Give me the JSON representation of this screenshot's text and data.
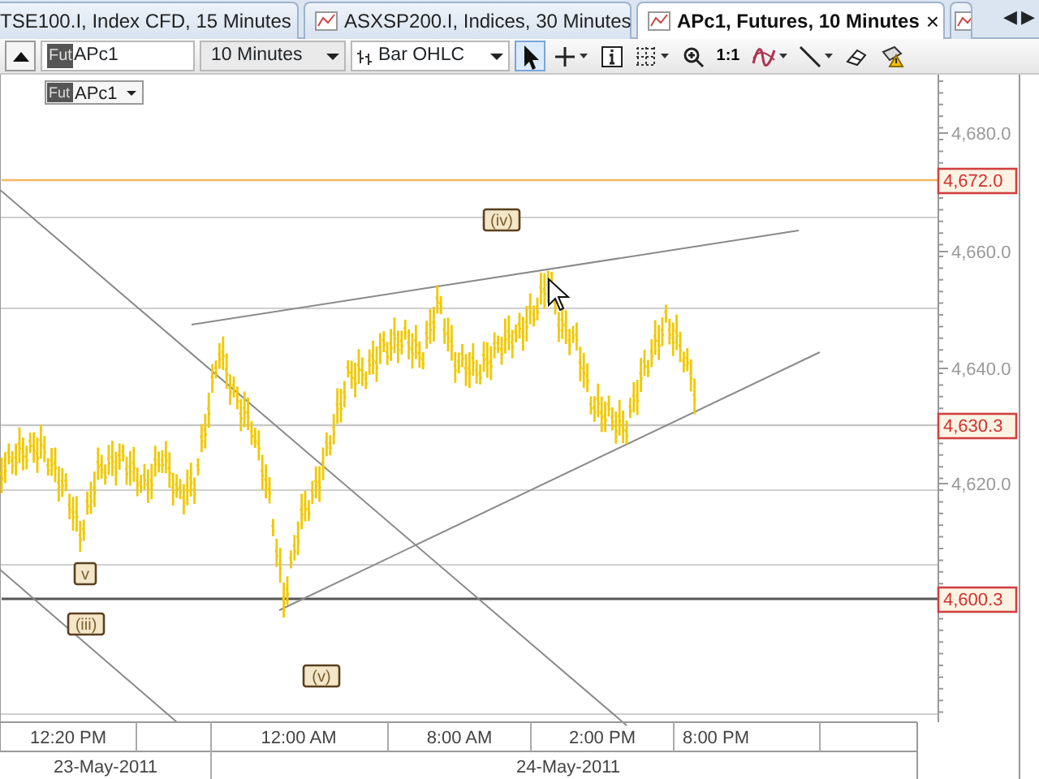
{
  "tabs": [
    {
      "label": "TSE100.I, Index CFD, 15 Minutes",
      "selected": false,
      "icon": false
    },
    {
      "label": "ASXSP200.I, Indices, 30 Minutes",
      "selected": false,
      "icon": true
    },
    {
      "label": "APc1, Futures, 10 Minutes",
      "selected": true,
      "icon": true
    }
  ],
  "tab_close": "×",
  "tab_scroll": [
    "◀",
    "▶"
  ],
  "toolbar": {
    "symbol_badge": "Fut",
    "symbol": "APc1",
    "interval": "10 Minutes",
    "chart_type": "Bar OHLC",
    "tools": [
      {
        "kind": "pointer",
        "selected": true
      },
      {
        "kind": "crosshair",
        "selected": false
      },
      {
        "kind": "info",
        "selected": false
      },
      {
        "kind": "grid",
        "selected": false
      },
      {
        "kind": "zoom",
        "selected": false
      },
      {
        "kind": "ratio",
        "label": "1:1",
        "selected": false
      },
      {
        "kind": "indicator",
        "selected": false
      },
      {
        "kind": "line",
        "selected": false
      },
      {
        "kind": "eraser",
        "selected": false
      },
      {
        "kind": "alert",
        "selected": false
      }
    ]
  },
  "legend": {
    "badge": "Fut",
    "symbol": "APc1"
  },
  "price_axis": {
    "ticks": [
      "4,680.0",
      "4,660.0",
      "4,640.0",
      "4,620.0"
    ],
    "tags": [
      "4,672.0",
      "4,630.3",
      "4,600.3"
    ]
  },
  "wave_labels": [
    "(iv)",
    "v",
    "(iii)",
    "(v)"
  ],
  "time_axis": {
    "times": [
      "12:20 PM",
      "12:00 AM",
      "8:00 AM",
      "2:00 PM",
      "8:00 PM"
    ],
    "dates": [
      "23-May-2011",
      "24-May-2011"
    ]
  }
}
